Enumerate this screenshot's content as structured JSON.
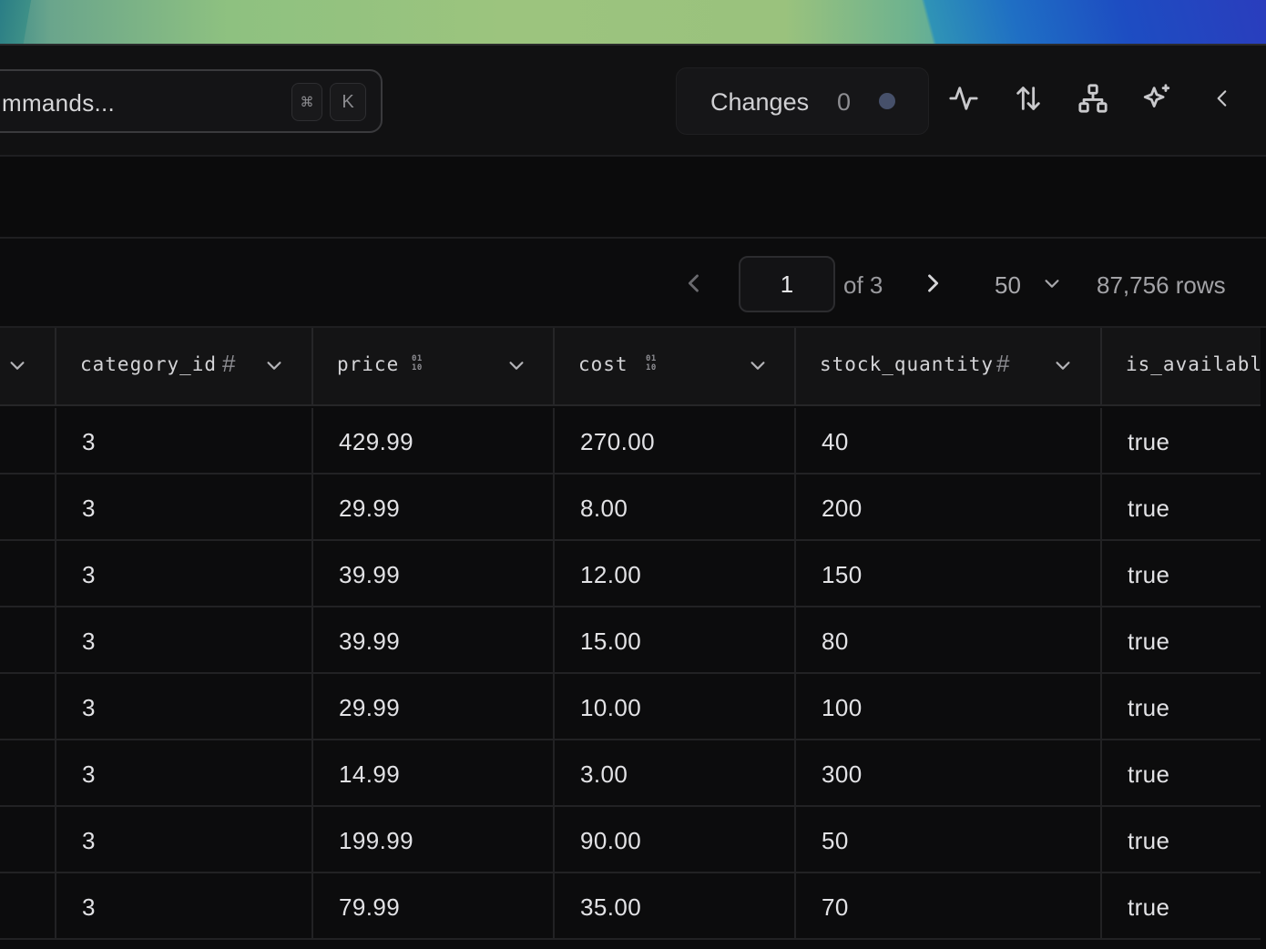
{
  "toolbar": {
    "command_placeholder": "mmands...",
    "shortcut_modifier": "⌘",
    "shortcut_key": "K",
    "changes_label": "Changes",
    "changes_count": "0",
    "icons": [
      "activity-icon",
      "sort-arrows-icon",
      "schema-tree-icon",
      "sparkles-icon",
      "collapse-chevron-left-icon"
    ]
  },
  "pagination": {
    "current_page": "1",
    "of_pages": "of 3",
    "page_size": "50",
    "row_count": "87,756 rows"
  },
  "table": {
    "columns": [
      {
        "name": "",
        "type": ""
      },
      {
        "name": "category_id",
        "type": "#"
      },
      {
        "name": "price",
        "type": "01\n10"
      },
      {
        "name": "cost",
        "type": "01\n10"
      },
      {
        "name": "stock_quantity",
        "type": "#"
      },
      {
        "name": "is_available",
        "type": ""
      }
    ],
    "rows": [
      [
        "",
        "3",
        "429.99",
        "270.00",
        "40",
        "true"
      ],
      [
        "",
        "3",
        "29.99",
        "8.00",
        "200",
        "true"
      ],
      [
        "",
        "3",
        "39.99",
        "12.00",
        "150",
        "true"
      ],
      [
        "",
        "3",
        "39.99",
        "15.00",
        "80",
        "true"
      ],
      [
        "",
        "3",
        "29.99",
        "10.00",
        "100",
        "true"
      ],
      [
        "",
        "3",
        "14.99",
        "3.00",
        "300",
        "true"
      ],
      [
        "",
        "3",
        "199.99",
        "90.00",
        "50",
        "true"
      ],
      [
        "",
        "3",
        "79.99",
        "35.00",
        "70",
        "true"
      ]
    ]
  },
  "colors": {
    "background": "#0c0c0d",
    "header_background": "#141415",
    "border": "#262628",
    "text": "#e2e2e5",
    "changes_dot": "#46506a"
  }
}
